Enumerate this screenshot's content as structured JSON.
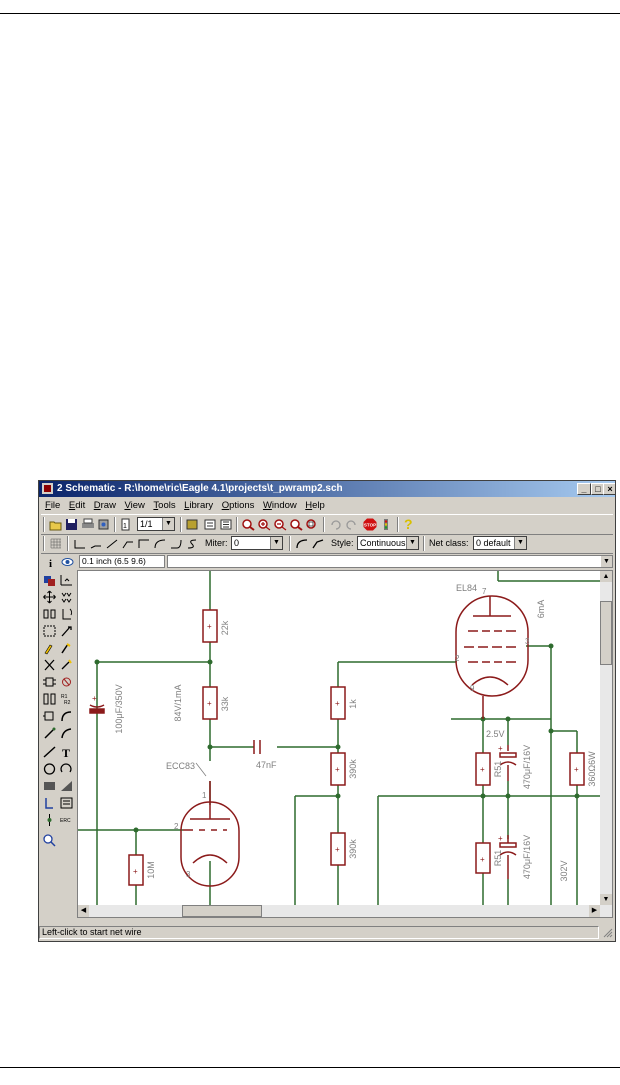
{
  "window": {
    "title": "2 Schematic - R:\\home\\ric\\Eagle 4.1\\projects\\t_pwramp2.sch",
    "buttons": {
      "minimize": "_",
      "maximize": "□",
      "close": "×"
    }
  },
  "menu": [
    "File",
    "Edit",
    "Draw",
    "View",
    "Tools",
    "Library",
    "Options",
    "Window",
    "Help"
  ],
  "toolbar": {
    "sheet_select": "1/1",
    "stop_label": "STOP",
    "help_symbol": "?"
  },
  "paramsbar": {
    "miter_label": "Miter:",
    "miter_value": "0",
    "style_label": "Style:",
    "style_value": "Continuous",
    "netclass_label": "Net class:",
    "netclass_value": "0 default"
  },
  "coord_display": "0.1 inch (6.5 9.6)",
  "status": "Left-click to start net wire",
  "schematic": {
    "part_labels": {
      "el84": "EL84",
      "ecc83": "ECC83",
      "r22k": "22k",
      "r33k": "33k",
      "r1k": "1k",
      "r390k_a": "390k",
      "r390k_b": "390k",
      "r10m": "10M",
      "r51_a": "R51",
      "r51_b": "R51",
      "r360": "360Ω6W",
      "c100": "100μF/350V",
      "c47": "47nF",
      "c470_a": "470μF/16V",
      "c470_b": "470μF/16V",
      "ann_84v": "84V/1mA",
      "ann_65ma": "6mA",
      "ann_25v": "2.5V",
      "ann_302v": "302V"
    },
    "pins": {
      "p1": "1",
      "p2": "2",
      "p3": "3",
      "p7": "7",
      "p9": "9",
      "p2b": "2",
      "p3b": "3"
    }
  },
  "colors": {
    "net": "#2e6b2e",
    "part": "#8b1a1a",
    "titlebar_start": "#0a246a",
    "titlebar_end": "#a6caf0",
    "window_bg": "#d4d0c8"
  }
}
